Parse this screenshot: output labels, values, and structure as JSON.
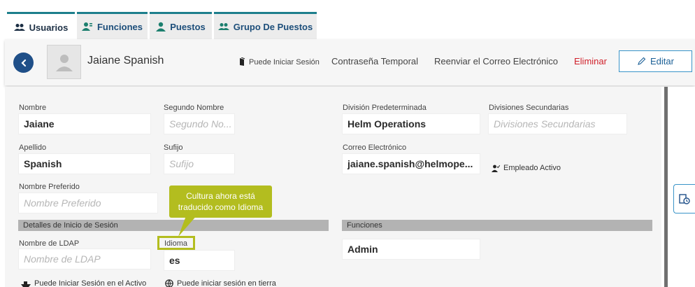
{
  "tabs": [
    {
      "label": "Usuarios",
      "icon": "users-icon",
      "active": true
    },
    {
      "label": "Funciones",
      "icon": "role-icon",
      "active": false
    },
    {
      "label": "Puestos",
      "icon": "person-icon",
      "active": false
    },
    {
      "label": "Grupo De Puestos",
      "icon": "users-group-icon",
      "active": false
    }
  ],
  "header": {
    "user_name": "Jaiane Spanish",
    "can_login": "Puede Iniciar Sesión",
    "temp_password": "Contraseña Temporal",
    "resend_email": "Reenviar el Correo Electrónico",
    "delete": "Eliminar",
    "edit": "Editar"
  },
  "form": {
    "first_name_label": "Nombre",
    "first_name_value": "Jaiane",
    "middle_name_label": "Segundo Nombre",
    "middle_name_placeholder": "Segundo No...",
    "last_name_label": "Apellido",
    "last_name_value": "Spanish",
    "suffix_label": "Sufijo",
    "suffix_placeholder": "Sufijo",
    "preferred_name_label": "Nombre Preferido",
    "preferred_name_placeholder": "Nombre Preferido",
    "default_division_label": "División Predeterminada",
    "default_division_value": "Helm Operations",
    "secondary_divisions_label": "Divisiones Secundarias",
    "secondary_divisions_placeholder": "Divisiones Secundarias",
    "email_label": "Correo Electrónico",
    "email_value": "jaiane.spanish@helmope...",
    "active_employee": "Empleado Activo",
    "login_section": "Detalles de Inicio de Sesión",
    "ldap_label": "Nombre de LDAP",
    "ldap_placeholder": "Nombre de LDAP",
    "language_label": "Idioma",
    "language_value": "es",
    "roles_section": "Funciones",
    "role_value": "Admin",
    "can_login_asset": "Puede Iniciar Sesión en el Activo",
    "can_login_shore": "Puede iniciar sesión en tierra"
  },
  "callout": {
    "line1": "Cultura ahora está",
    "line2": "traducido como Idioma"
  },
  "colors": {
    "tab_accent": "#1d7f8c",
    "primary": "#1f4f88",
    "danger": "#d0202a",
    "callout": "#b3bd1f"
  }
}
